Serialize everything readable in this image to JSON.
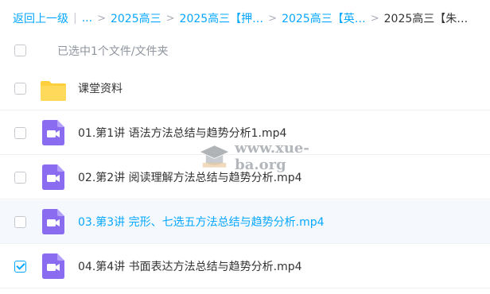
{
  "breadcrumb": {
    "back": "返回上一级",
    "ellipsis": "...",
    "items": [
      "2025高三",
      "2025高三【押…",
      "2025高三【英…"
    ],
    "current": "2025高三【朱…"
  },
  "selection": {
    "label": "已选中1个文件/文件夹"
  },
  "files": [
    {
      "name": "课堂资料",
      "type": "folder",
      "checked": false
    },
    {
      "name": "01.第1讲 语法方法总结与趋势分析1.mp4",
      "type": "video",
      "checked": false
    },
    {
      "name": "02.第2讲 阅读理解方法总结与趋势分析.mp4",
      "type": "video",
      "checked": false
    },
    {
      "name": "03.第3讲 完形、七选五方法总结与趋势分析.mp4",
      "type": "video",
      "checked": false
    },
    {
      "name": "04.第4讲 书面表达方法总结与趋势分析.mp4",
      "type": "video",
      "checked": true
    }
  ],
  "watermark": {
    "text": "www.xue-ba.org"
  },
  "colors": {
    "accent": "#06a7ff",
    "folder": "#ffcf3d",
    "video": "#8a6cf0"
  }
}
